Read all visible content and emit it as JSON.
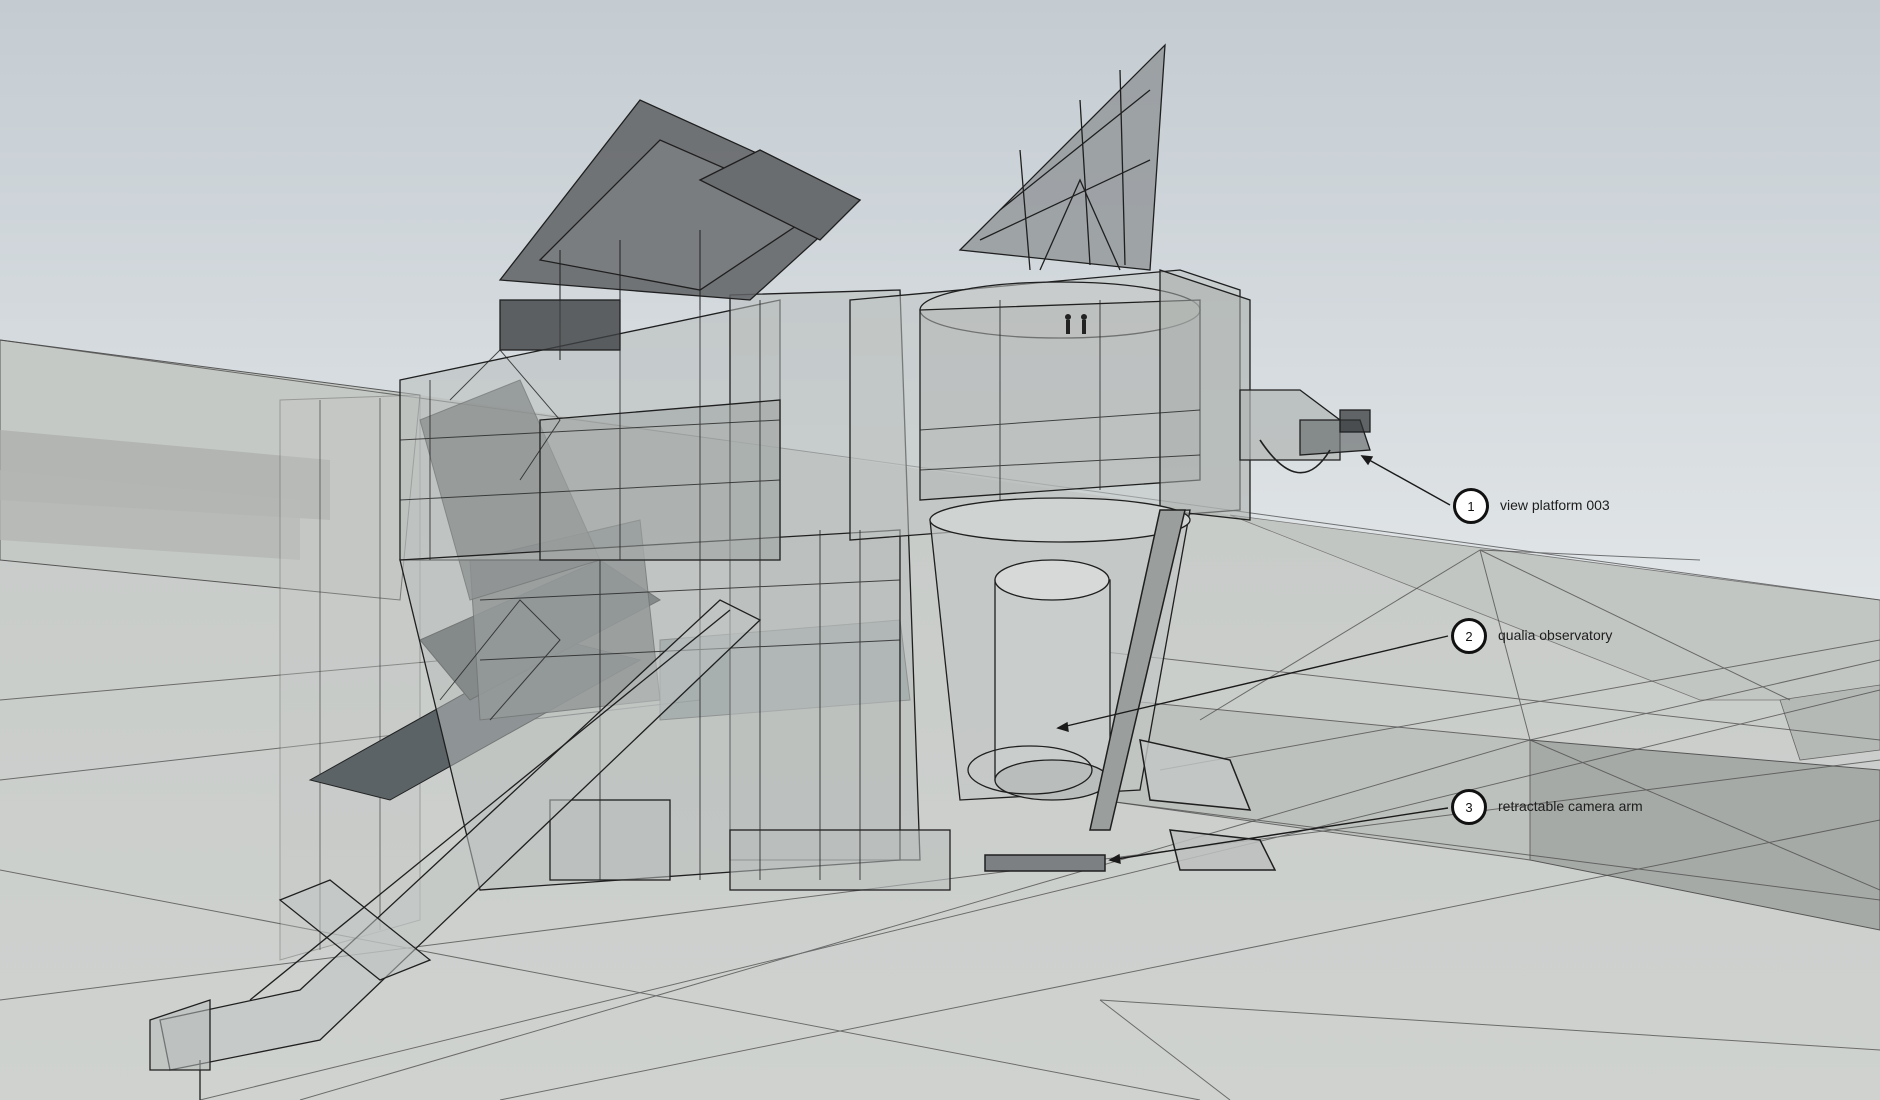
{
  "annotations": [
    {
      "number": "1",
      "label": "view platform 003"
    },
    {
      "number": "2",
      "label": "qualia observatory"
    },
    {
      "number": "3",
      "label": "retractable camera arm"
    }
  ],
  "colors": {
    "sky_top": "#c4ccd2",
    "sky_bottom": "#e2e6e8",
    "ground": "#c9ccc9",
    "glass": "#b9bebc",
    "dark_panel": "#4a4d4f",
    "line": "#1a1a1a"
  }
}
